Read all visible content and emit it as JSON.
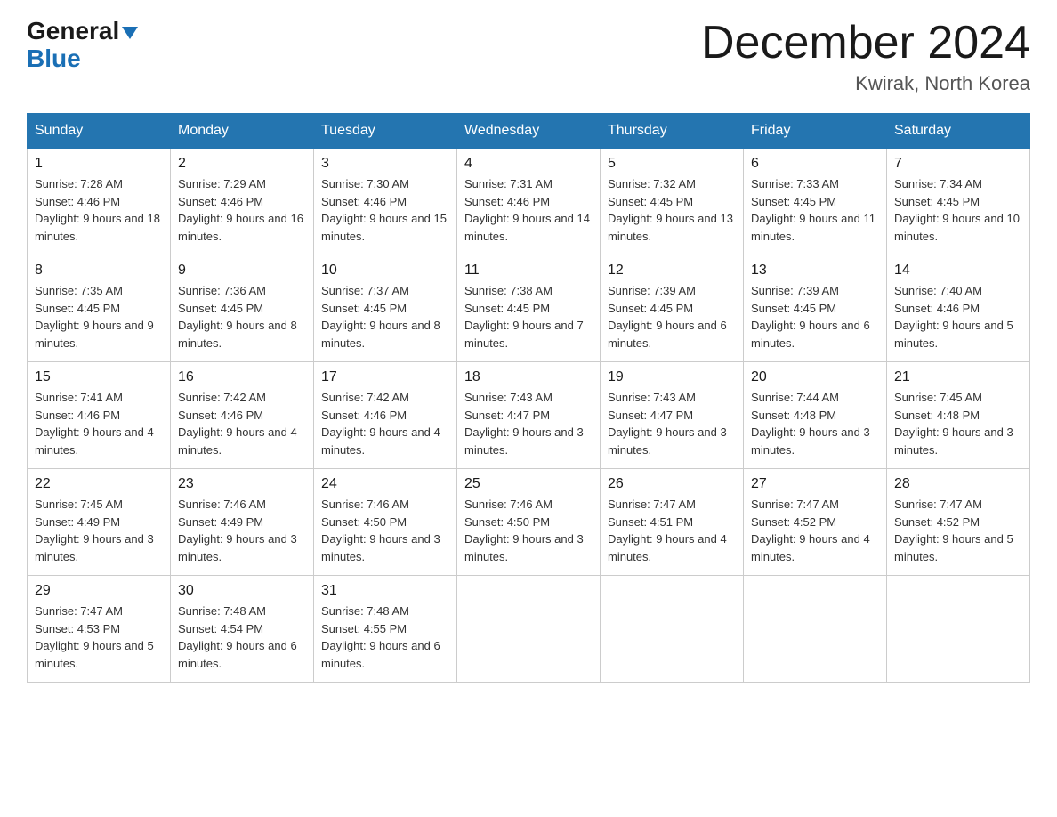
{
  "logo": {
    "general": "General",
    "blue": "Blue",
    "triangle": "▶"
  },
  "title": "December 2024",
  "location": "Kwirak, North Korea",
  "headers": [
    "Sunday",
    "Monday",
    "Tuesday",
    "Wednesday",
    "Thursday",
    "Friday",
    "Saturday"
  ],
  "weeks": [
    [
      {
        "day": "1",
        "sunrise": "7:28 AM",
        "sunset": "4:46 PM",
        "daylight": "9 hours and 18 minutes."
      },
      {
        "day": "2",
        "sunrise": "7:29 AM",
        "sunset": "4:46 PM",
        "daylight": "9 hours and 16 minutes."
      },
      {
        "day": "3",
        "sunrise": "7:30 AM",
        "sunset": "4:46 PM",
        "daylight": "9 hours and 15 minutes."
      },
      {
        "day": "4",
        "sunrise": "7:31 AM",
        "sunset": "4:46 PM",
        "daylight": "9 hours and 14 minutes."
      },
      {
        "day": "5",
        "sunrise": "7:32 AM",
        "sunset": "4:45 PM",
        "daylight": "9 hours and 13 minutes."
      },
      {
        "day": "6",
        "sunrise": "7:33 AM",
        "sunset": "4:45 PM",
        "daylight": "9 hours and 11 minutes."
      },
      {
        "day": "7",
        "sunrise": "7:34 AM",
        "sunset": "4:45 PM",
        "daylight": "9 hours and 10 minutes."
      }
    ],
    [
      {
        "day": "8",
        "sunrise": "7:35 AM",
        "sunset": "4:45 PM",
        "daylight": "9 hours and 9 minutes."
      },
      {
        "day": "9",
        "sunrise": "7:36 AM",
        "sunset": "4:45 PM",
        "daylight": "9 hours and 8 minutes."
      },
      {
        "day": "10",
        "sunrise": "7:37 AM",
        "sunset": "4:45 PM",
        "daylight": "9 hours and 8 minutes."
      },
      {
        "day": "11",
        "sunrise": "7:38 AM",
        "sunset": "4:45 PM",
        "daylight": "9 hours and 7 minutes."
      },
      {
        "day": "12",
        "sunrise": "7:39 AM",
        "sunset": "4:45 PM",
        "daylight": "9 hours and 6 minutes."
      },
      {
        "day": "13",
        "sunrise": "7:39 AM",
        "sunset": "4:45 PM",
        "daylight": "9 hours and 6 minutes."
      },
      {
        "day": "14",
        "sunrise": "7:40 AM",
        "sunset": "4:46 PM",
        "daylight": "9 hours and 5 minutes."
      }
    ],
    [
      {
        "day": "15",
        "sunrise": "7:41 AM",
        "sunset": "4:46 PM",
        "daylight": "9 hours and 4 minutes."
      },
      {
        "day": "16",
        "sunrise": "7:42 AM",
        "sunset": "4:46 PM",
        "daylight": "9 hours and 4 minutes."
      },
      {
        "day": "17",
        "sunrise": "7:42 AM",
        "sunset": "4:46 PM",
        "daylight": "9 hours and 4 minutes."
      },
      {
        "day": "18",
        "sunrise": "7:43 AM",
        "sunset": "4:47 PM",
        "daylight": "9 hours and 3 minutes."
      },
      {
        "day": "19",
        "sunrise": "7:43 AM",
        "sunset": "4:47 PM",
        "daylight": "9 hours and 3 minutes."
      },
      {
        "day": "20",
        "sunrise": "7:44 AM",
        "sunset": "4:48 PM",
        "daylight": "9 hours and 3 minutes."
      },
      {
        "day": "21",
        "sunrise": "7:45 AM",
        "sunset": "4:48 PM",
        "daylight": "9 hours and 3 minutes."
      }
    ],
    [
      {
        "day": "22",
        "sunrise": "7:45 AM",
        "sunset": "4:49 PM",
        "daylight": "9 hours and 3 minutes."
      },
      {
        "day": "23",
        "sunrise": "7:46 AM",
        "sunset": "4:49 PM",
        "daylight": "9 hours and 3 minutes."
      },
      {
        "day": "24",
        "sunrise": "7:46 AM",
        "sunset": "4:50 PM",
        "daylight": "9 hours and 3 minutes."
      },
      {
        "day": "25",
        "sunrise": "7:46 AM",
        "sunset": "4:50 PM",
        "daylight": "9 hours and 3 minutes."
      },
      {
        "day": "26",
        "sunrise": "7:47 AM",
        "sunset": "4:51 PM",
        "daylight": "9 hours and 4 minutes."
      },
      {
        "day": "27",
        "sunrise": "7:47 AM",
        "sunset": "4:52 PM",
        "daylight": "9 hours and 4 minutes."
      },
      {
        "day": "28",
        "sunrise": "7:47 AM",
        "sunset": "4:52 PM",
        "daylight": "9 hours and 5 minutes."
      }
    ],
    [
      {
        "day": "29",
        "sunrise": "7:47 AM",
        "sunset": "4:53 PM",
        "daylight": "9 hours and 5 minutes."
      },
      {
        "day": "30",
        "sunrise": "7:48 AM",
        "sunset": "4:54 PM",
        "daylight": "9 hours and 6 minutes."
      },
      {
        "day": "31",
        "sunrise": "7:48 AM",
        "sunset": "4:55 PM",
        "daylight": "9 hours and 6 minutes."
      },
      null,
      null,
      null,
      null
    ]
  ]
}
